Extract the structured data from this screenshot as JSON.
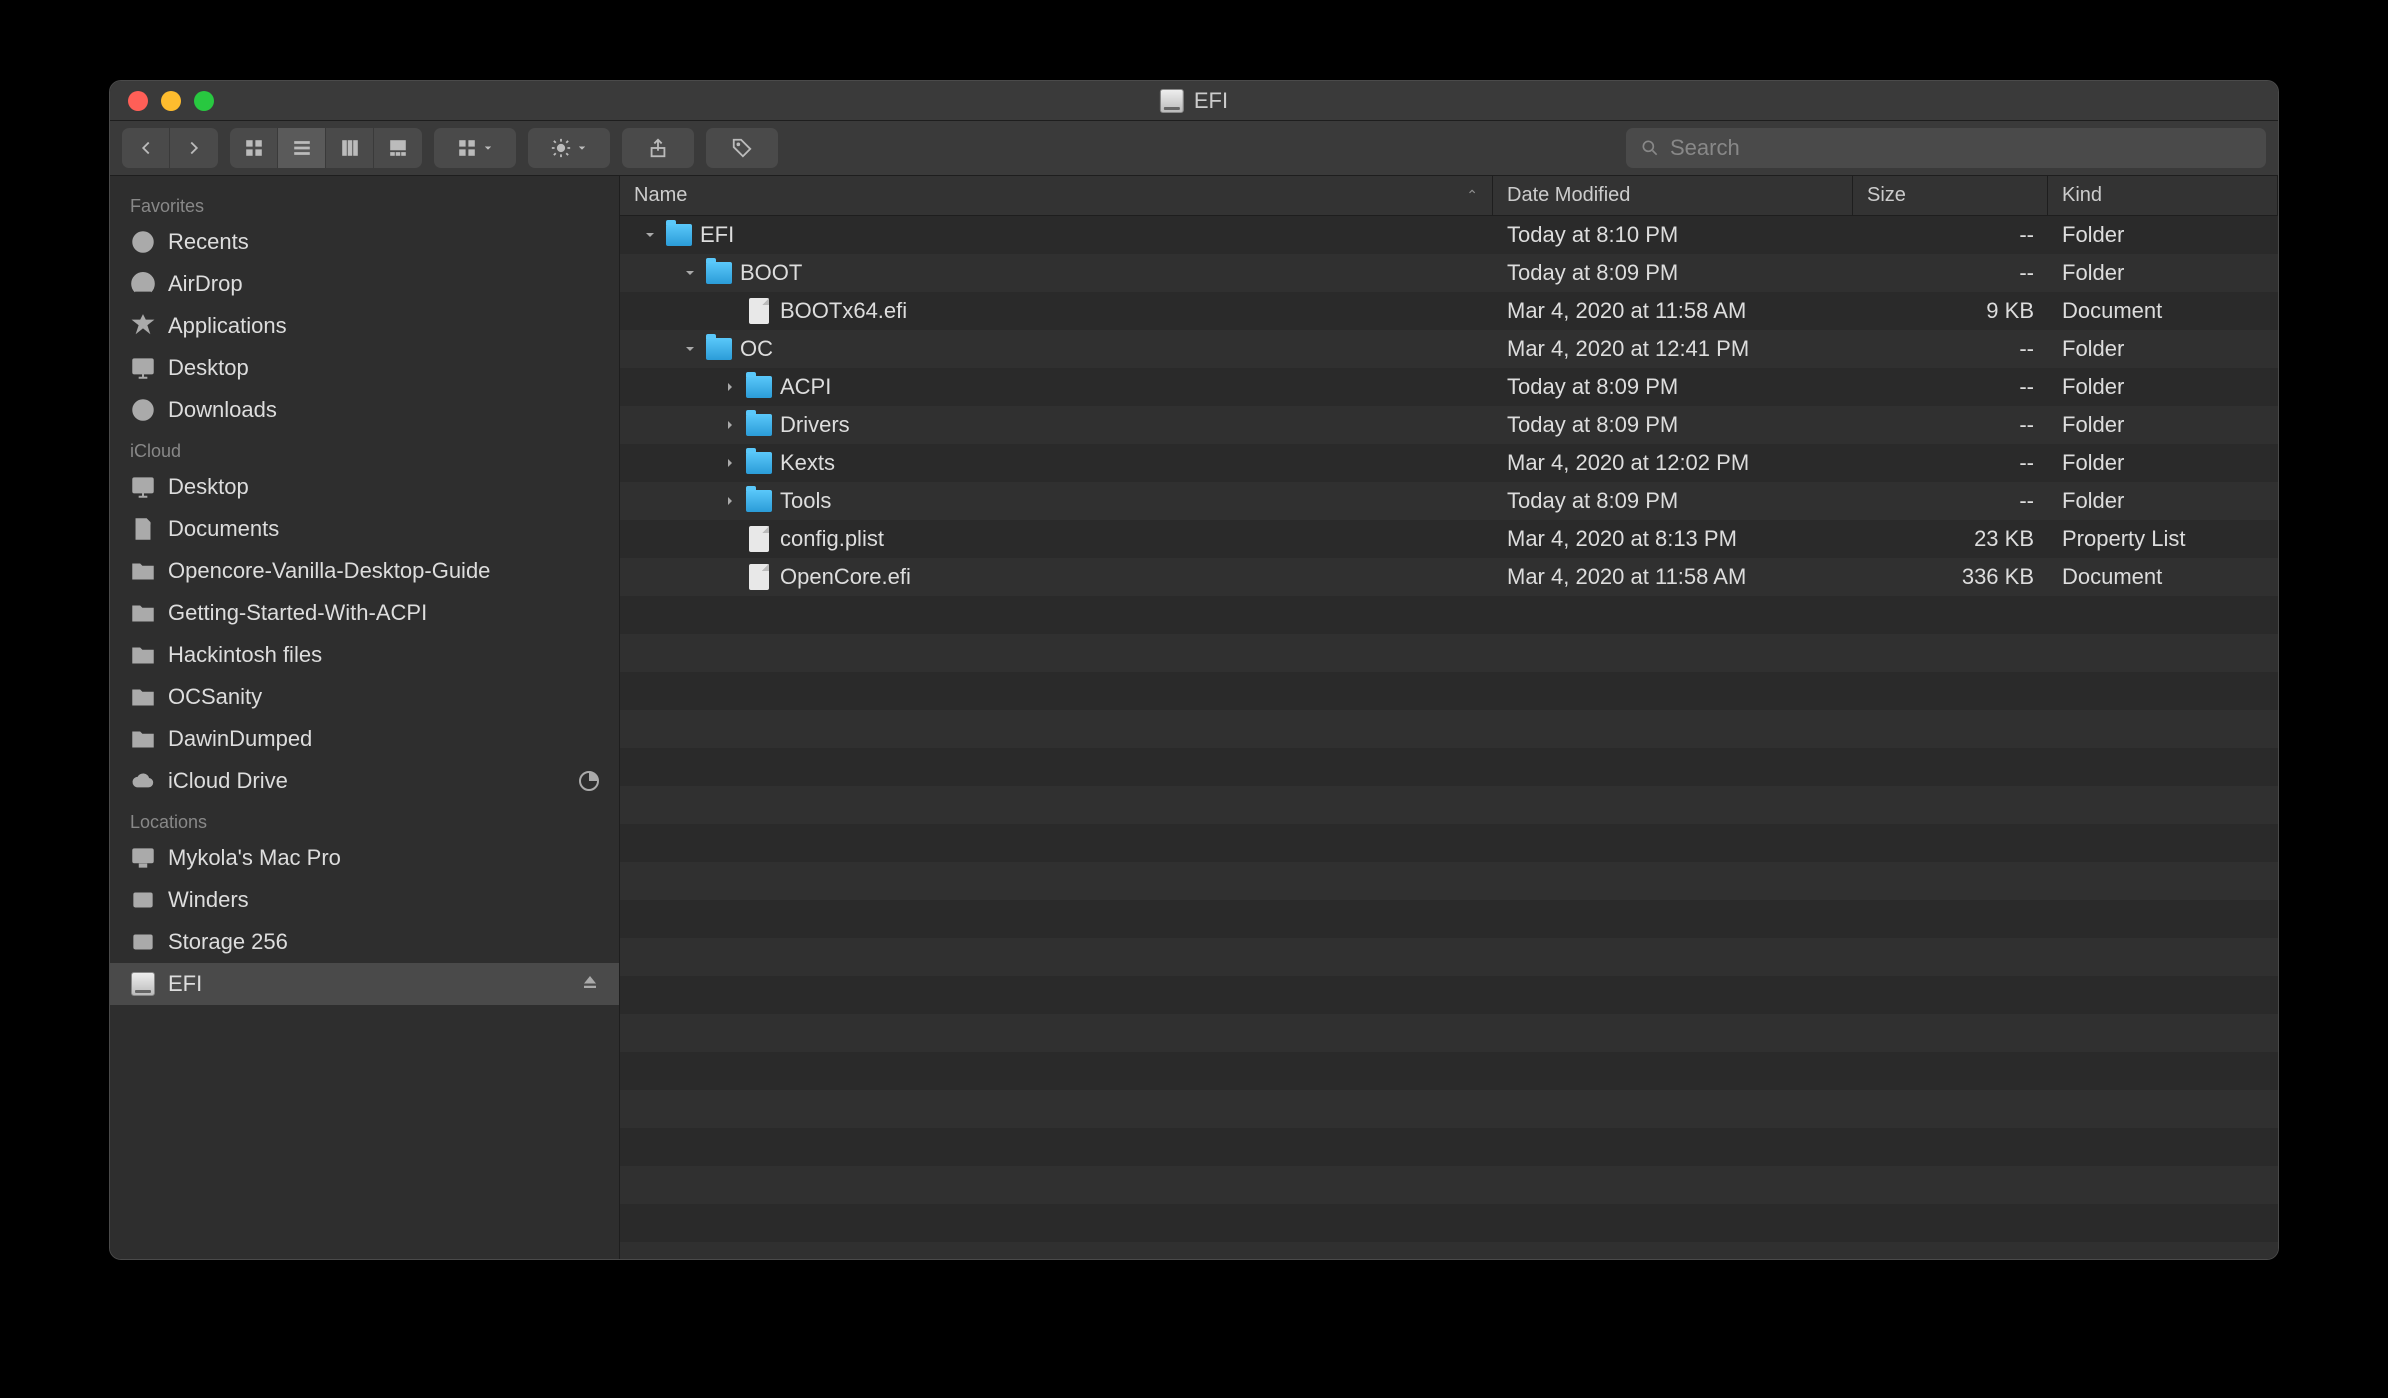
{
  "window": {
    "title": "EFI"
  },
  "toolbar": {
    "search_placeholder": "Search"
  },
  "sidebar": {
    "sections": [
      {
        "title": "Favorites",
        "items": [
          {
            "label": "Recents",
            "icon": "clock"
          },
          {
            "label": "AirDrop",
            "icon": "airdrop"
          },
          {
            "label": "Applications",
            "icon": "apps"
          },
          {
            "label": "Desktop",
            "icon": "desktop"
          },
          {
            "label": "Downloads",
            "icon": "downloads"
          }
        ]
      },
      {
        "title": "iCloud",
        "items": [
          {
            "label": "Desktop",
            "icon": "desktop"
          },
          {
            "label": "Documents",
            "icon": "doc"
          },
          {
            "label": "Opencore-Vanilla-Desktop-Guide",
            "icon": "folder"
          },
          {
            "label": "Getting-Started-With-ACPI",
            "icon": "folder"
          },
          {
            "label": "Hackintosh files",
            "icon": "folder"
          },
          {
            "label": "OCSanity",
            "icon": "folder"
          },
          {
            "label": "DawinDumped",
            "icon": "folder"
          },
          {
            "label": "iCloud Drive",
            "icon": "cloud",
            "trailing": "pie"
          }
        ]
      },
      {
        "title": "Locations",
        "items": [
          {
            "label": "Mykola's Mac Pro",
            "icon": "computer"
          },
          {
            "label": "Winders",
            "icon": "hdd"
          },
          {
            "label": "Storage 256",
            "icon": "hdd"
          },
          {
            "label": "EFI",
            "icon": "disk",
            "selected": true,
            "trailing": "eject"
          }
        ]
      }
    ]
  },
  "columns": {
    "name": "Name",
    "date": "Date Modified",
    "size": "Size",
    "kind": "Kind"
  },
  "files": [
    {
      "depth": 0,
      "expand": "down",
      "type": "folder",
      "name": "EFI",
      "date": "Today at 8:10 PM",
      "size": "--",
      "kind": "Folder"
    },
    {
      "depth": 1,
      "expand": "down",
      "type": "folder",
      "name": "BOOT",
      "date": "Today at 8:09 PM",
      "size": "--",
      "kind": "Folder"
    },
    {
      "depth": 2,
      "expand": "",
      "type": "file",
      "name": "BOOTx64.efi",
      "date": "Mar 4, 2020 at 11:58 AM",
      "size": "9 KB",
      "kind": "Document"
    },
    {
      "depth": 1,
      "expand": "down",
      "type": "folder",
      "name": "OC",
      "date": "Mar 4, 2020 at 12:41 PM",
      "size": "--",
      "kind": "Folder"
    },
    {
      "depth": 2,
      "expand": "right",
      "type": "folder",
      "name": "ACPI",
      "date": "Today at 8:09 PM",
      "size": "--",
      "kind": "Folder"
    },
    {
      "depth": 2,
      "expand": "right",
      "type": "folder",
      "name": "Drivers",
      "date": "Today at 8:09 PM",
      "size": "--",
      "kind": "Folder"
    },
    {
      "depth": 2,
      "expand": "right",
      "type": "folder",
      "name": "Kexts",
      "date": "Mar 4, 2020 at 12:02 PM",
      "size": "--",
      "kind": "Folder"
    },
    {
      "depth": 2,
      "expand": "right",
      "type": "folder",
      "name": "Tools",
      "date": "Today at 8:09 PM",
      "size": "--",
      "kind": "Folder"
    },
    {
      "depth": 2,
      "expand": "",
      "type": "file",
      "name": "config.plist",
      "date": "Mar 4, 2020 at 8:13 PM",
      "size": "23 KB",
      "kind": "Property List"
    },
    {
      "depth": 2,
      "expand": "",
      "type": "file",
      "name": "OpenCore.efi",
      "date": "Mar 4, 2020 at 11:58 AM",
      "size": "336 KB",
      "kind": "Document"
    }
  ]
}
